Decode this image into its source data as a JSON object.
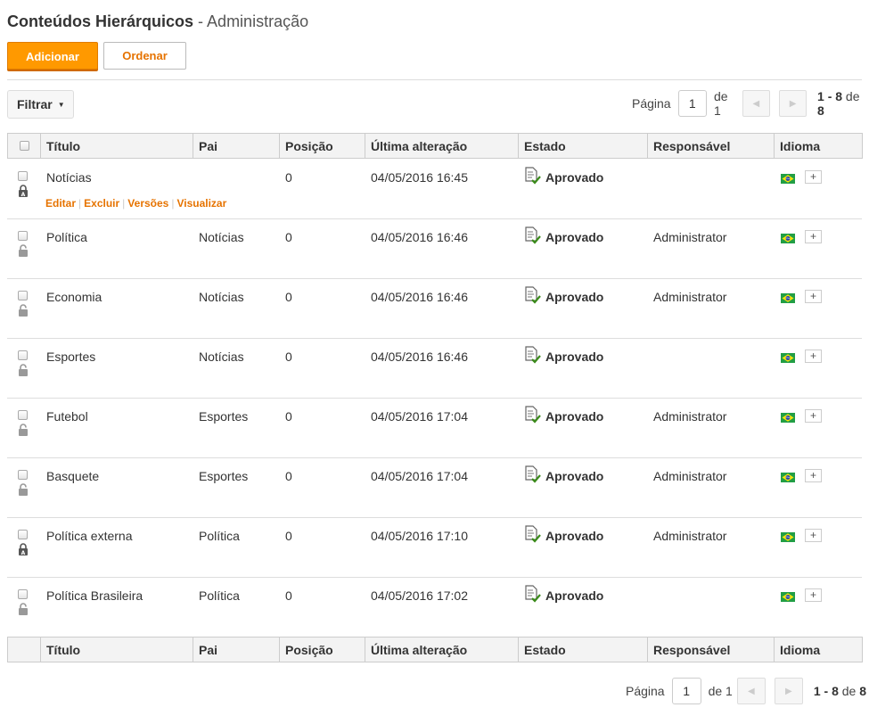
{
  "header": {
    "title": "Conteúdos Hierárquicos",
    "subtitle": "- Administração"
  },
  "toolbar": {
    "add_label": "Adicionar",
    "order_label": "Ordenar"
  },
  "filter": {
    "label": "Filtrar"
  },
  "pagination": {
    "page_label": "Página",
    "current_page": "1",
    "of_label": "de 1",
    "range": "1 - 8",
    "range_of": "de",
    "total": "8"
  },
  "table": {
    "columns": [
      "Título",
      "Pai",
      "Posição",
      "Última alteração",
      "Estado",
      "Responsável",
      "Idioma"
    ],
    "row_actions": [
      "Editar",
      "Excluir",
      "Versões",
      "Visualizar"
    ],
    "rows": [
      {
        "title": "Notícias",
        "parent": "",
        "position": "0",
        "modified": "04/05/2016 16:45",
        "status": "Aprovado",
        "owner": "",
        "lock": "closed"
      },
      {
        "title": "Política",
        "parent": "Notícias",
        "position": "0",
        "modified": "04/05/2016 16:46",
        "status": "Aprovado",
        "owner": "Administrator",
        "lock": "open"
      },
      {
        "title": "Economia",
        "parent": "Notícias",
        "position": "0",
        "modified": "04/05/2016 16:46",
        "status": "Aprovado",
        "owner": "Administrator",
        "lock": "open"
      },
      {
        "title": "Esportes",
        "parent": "Notícias",
        "position": "0",
        "modified": "04/05/2016 16:46",
        "status": "Aprovado",
        "owner": "",
        "lock": "open"
      },
      {
        "title": "Futebol",
        "parent": "Esportes",
        "position": "0",
        "modified": "04/05/2016 17:04",
        "status": "Aprovado",
        "owner": "Administrator",
        "lock": "open"
      },
      {
        "title": "Basquete",
        "parent": "Esportes",
        "position": "0",
        "modified": "04/05/2016 17:04",
        "status": "Aprovado",
        "owner": "Administrator",
        "lock": "open"
      },
      {
        "title": "Política externa",
        "parent": "Política",
        "position": "0",
        "modified": "04/05/2016 17:10",
        "status": "Aprovado",
        "owner": "Administrator",
        "lock": "closed"
      },
      {
        "title": "Política Brasileira",
        "parent": "Política",
        "position": "0",
        "modified": "04/05/2016 17:02",
        "status": "Aprovado",
        "owner": "",
        "lock": "open"
      }
    ]
  },
  "colors": {
    "accent": "#ff9900",
    "link": "#e67300",
    "status_ok": "#4a9a2a"
  },
  "icons": {
    "flag": "brazil-flag-icon",
    "status": "document-check-icon",
    "lock": "lock-icon",
    "add_language": "plus-icon"
  }
}
